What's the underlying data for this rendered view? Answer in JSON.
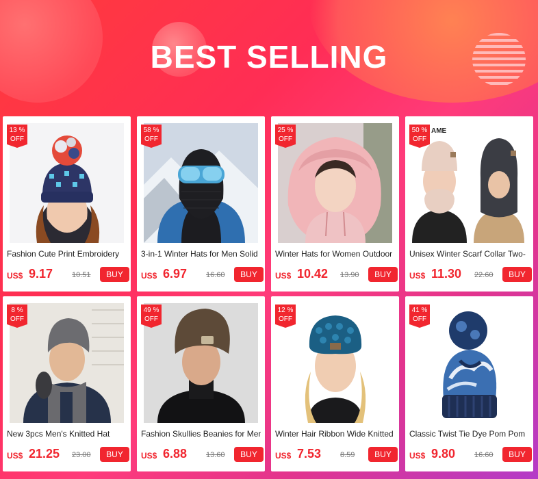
{
  "banner": {
    "title": "BEST SELLING"
  },
  "currency": "US$",
  "colors": {
    "accent": "#f1262f",
    "background_start": "#ff3b3b",
    "background_end": "#b33bc8"
  },
  "products": [
    {
      "discount_pct": "13 %",
      "off": "OFF",
      "name": "Fashion Cute Print Embroidery",
      "price": "9.17",
      "original_price": "10.51",
      "buy_label": "BUY"
    },
    {
      "discount_pct": "58 %",
      "off": "OFF",
      "name": "3-in-1 Winter Hats for Men Solid",
      "price": "6.97",
      "original_price": "16.60",
      "buy_label": "BUY"
    },
    {
      "discount_pct": "25 %",
      "off": "OFF",
      "name": "Winter Hats for Women Outdoor",
      "price": "10.42",
      "original_price": "13.90",
      "buy_label": "BUY"
    },
    {
      "discount_pct": "50 %",
      "off": "OFF",
      "name": "Unisex Winter Scarf Collar Two-",
      "price": "11.30",
      "original_price": "22.60",
      "buy_label": "BUY",
      "image_text": "AME"
    },
    {
      "discount_pct": "8  %",
      "off": "OFF",
      "name": "New 3pcs Men's Knitted Hat",
      "price": "21.25",
      "original_price": "23.00",
      "buy_label": "BUY"
    },
    {
      "discount_pct": "49 %",
      "off": "OFF",
      "name": "Fashion Skullies Beanies for Men",
      "price": "6.88",
      "original_price": "13.60",
      "buy_label": "BUY"
    },
    {
      "discount_pct": "12 %",
      "off": "OFF",
      "name": "Winter Hair Ribbon Wide Knitted",
      "price": "7.53",
      "original_price": "8.59",
      "buy_label": "BUY"
    },
    {
      "discount_pct": "41 %",
      "off": "OFF",
      "name": "Classic Twist Tie Dye Pom Pom",
      "price": "9.80",
      "original_price": "16.60",
      "buy_label": "BUY"
    }
  ]
}
